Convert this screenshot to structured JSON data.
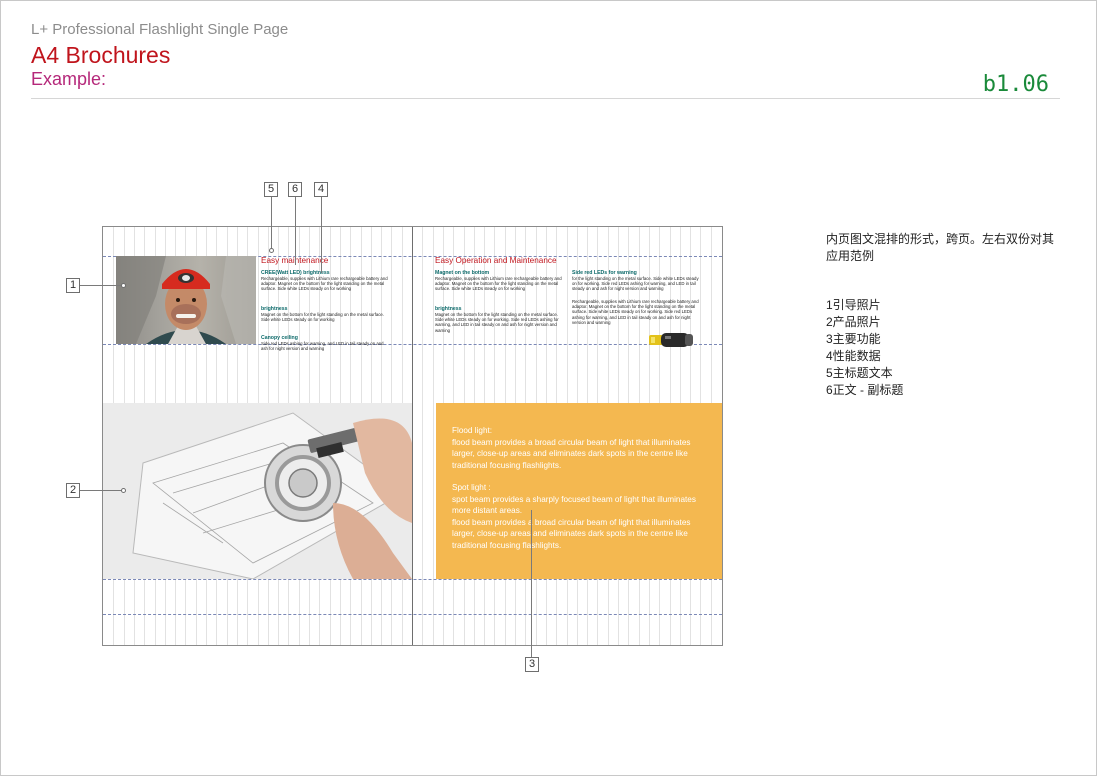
{
  "header": {
    "subtitle": "L+ Professional Flashlight Single Page",
    "title": "A4 Brochures",
    "example_label": "Example:",
    "page_code": "b1.06"
  },
  "left_page": {
    "heading": "Easy maintenance",
    "blocks": [
      {
        "subhead": "CREE(Watt LED) brightness",
        "body": "Rechargeable, supplies with Lithium rare rechargeable battery and adaptor. Magnet on the bottom for the light standing on the metal surface. Side white LEDs steady on for working"
      },
      {
        "subhead": "brightness",
        "body": "Magnet on the bottom for the light standing on the metal surface. Side white LEDs steady on for working"
      },
      {
        "subhead": "Canopy ceiling",
        "body": "Side red LEDs      ashing for warning, and LED in tail steady on and ash for night version and warning"
      }
    ]
  },
  "right_page": {
    "heading": "Easy Operation and Maintenance",
    "col1": [
      {
        "subhead": "Magnet on the bottom",
        "body": "Rechargeable, supplies with Lithium rare rechargeable battery and adaptor. Magnet on the bottom for the light standing on the metal surface. Side white LEDs steady on for working"
      },
      {
        "subhead": "brightness",
        "body": "Magnet on the bottom for the light standing on the metal surface. Side white LEDs steady on for working. Side red LEDs ashing for warning, and LED in tail steady on and ash for night version and warning"
      }
    ],
    "col2": [
      {
        "subhead": "Side red LEDs for warning",
        "body": "for the light standing on the metal surface. Side white LEDs steady on for working. Side red LEDs      ashing for warning, and LED in tail steady on and ash for night version and warning"
      },
      {
        "subhead": "",
        "body": "Rechargeable, supplies with Lithium rare rechargeable battery and adaptor. Magnet on the bottom for the light standing on the metal surface. Side white LEDs steady on for working. Side red LEDs      ashing for warning, and LED in tail steady on and ash for night version and warning"
      }
    ],
    "orange_block": {
      "flood_title": "Flood light:",
      "flood_text": "flood beam provides a broad circular beam of light that illuminates larger, close-up areas and eliminates dark spots in the centre like traditional focusing flashlights.",
      "spot_title": "Spot light :",
      "spot_text": "spot beam provides a sharply focused beam of light that illuminates more distant areas.",
      "flood_text2": "flood beam provides a broad circular beam of light that illuminates larger, close-up areas and eliminates dark spots in the centre like traditional focusing flashlights."
    }
  },
  "callouts": {
    "c1": "1",
    "c2": "2",
    "c3": "3",
    "c4": "4",
    "c5": "5",
    "c6": "6"
  },
  "notes": {
    "line1": "内页图文混排的形式，跨页。左右双份对其",
    "line2": "应用范例"
  },
  "legend": [
    "1引导照片",
    "2产品照片",
    "3主要功能",
    "4性能数据",
    "5主标题文本",
    "6正文 - 副标题"
  ],
  "colors": {
    "title_red": "#c0141c",
    "example_magenta": "#b5287a",
    "code_green": "#1a8a3a",
    "orange_block": "#f4b850",
    "teal_subhead": "#0c6a6a"
  }
}
